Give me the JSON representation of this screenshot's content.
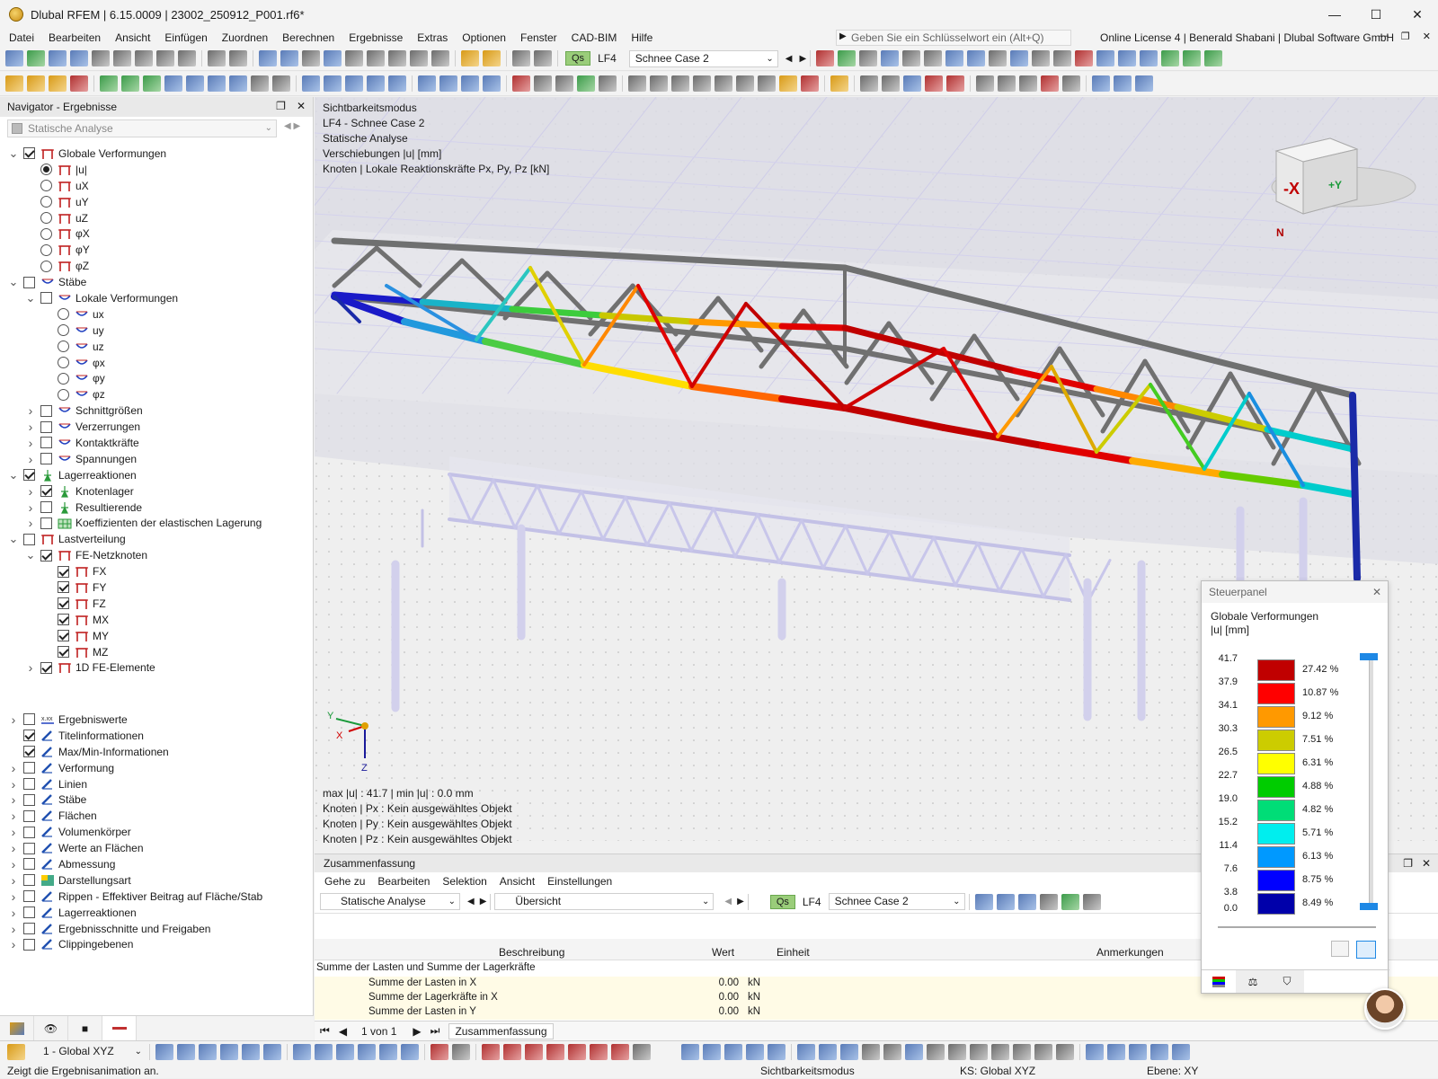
{
  "window": {
    "title": "Dlubal RFEM | 6.15.0009 | 23002_250912_P001.rf6*",
    "minimize": "—",
    "maximize": "☐",
    "close": "✕"
  },
  "menu": {
    "items": [
      "Datei",
      "Bearbeiten",
      "Ansicht",
      "Einfügen",
      "Zuordnen",
      "Berechnen",
      "Ergebnisse",
      "Extras",
      "Optionen",
      "Fenster",
      "CAD-BIM",
      "Hilfe"
    ],
    "search_placeholder": "Geben Sie ein Schlüsselwort ein (Alt+Q)",
    "license": "Online License 4 | Benerald Shabani | Dlubal Software GmbH"
  },
  "loadcase": {
    "badge": "Qs",
    "code": "LF4",
    "name": "Schnee Case 2"
  },
  "navigator": {
    "title": "Navigator - Ergebnisse",
    "combo": "Statische Analyse",
    "items": [
      {
        "label": "Globale Verformungen",
        "level": 0,
        "expand": "open",
        "ctl": "chk",
        "on": true,
        "icon": "red-frame"
      },
      {
        "label": "|u|",
        "level": 1,
        "expand": "",
        "ctl": "rad",
        "on": true,
        "icon": "red-frame"
      },
      {
        "label": "uX",
        "level": 1,
        "expand": "",
        "ctl": "rad",
        "on": false,
        "icon": "red-frame"
      },
      {
        "label": "uY",
        "level": 1,
        "expand": "",
        "ctl": "rad",
        "on": false,
        "icon": "red-frame"
      },
      {
        "label": "uZ",
        "level": 1,
        "expand": "",
        "ctl": "rad",
        "on": false,
        "icon": "red-frame"
      },
      {
        "label": "φX",
        "level": 1,
        "expand": "",
        "ctl": "rad",
        "on": false,
        "icon": "red-frame"
      },
      {
        "label": "φY",
        "level": 1,
        "expand": "",
        "ctl": "rad",
        "on": false,
        "icon": "red-frame"
      },
      {
        "label": "φZ",
        "level": 1,
        "expand": "",
        "ctl": "rad",
        "on": false,
        "icon": "red-frame"
      },
      {
        "label": "Stäbe",
        "level": 0,
        "expand": "open",
        "ctl": "chk",
        "on": false,
        "icon": "blue-beam"
      },
      {
        "label": "Lokale Verformungen",
        "level": 1,
        "expand": "open",
        "ctl": "chk",
        "on": false,
        "icon": "blue-beam"
      },
      {
        "label": "ux",
        "level": 2,
        "expand": "",
        "ctl": "rad",
        "on": false,
        "icon": "blue-beam"
      },
      {
        "label": "uy",
        "level": 2,
        "expand": "",
        "ctl": "rad",
        "on": false,
        "icon": "blue-beam"
      },
      {
        "label": "uz",
        "level": 2,
        "expand": "",
        "ctl": "rad",
        "on": false,
        "icon": "blue-beam"
      },
      {
        "label": "φx",
        "level": 2,
        "expand": "",
        "ctl": "rad",
        "on": false,
        "icon": "blue-beam"
      },
      {
        "label": "φy",
        "level": 2,
        "expand": "",
        "ctl": "rad",
        "on": false,
        "icon": "blue-beam"
      },
      {
        "label": "φz",
        "level": 2,
        "expand": "",
        "ctl": "rad",
        "on": false,
        "icon": "blue-beam"
      },
      {
        "label": "Schnittgrößen",
        "level": 1,
        "expand": "closed",
        "ctl": "chk",
        "on": false,
        "icon": "blue-beam"
      },
      {
        "label": "Verzerrungen",
        "level": 1,
        "expand": "closed",
        "ctl": "chk",
        "on": false,
        "icon": "blue-beam"
      },
      {
        "label": "Kontaktkräfte",
        "level": 1,
        "expand": "closed",
        "ctl": "chk",
        "on": false,
        "icon": "blue-beam"
      },
      {
        "label": "Spannungen",
        "level": 1,
        "expand": "closed",
        "ctl": "chk",
        "on": false,
        "icon": "blue-beam"
      },
      {
        "label": "Lagerreaktionen",
        "level": 0,
        "expand": "open",
        "ctl": "chk",
        "on": true,
        "icon": "green-support"
      },
      {
        "label": "Knotenlager",
        "level": 1,
        "expand": "closed",
        "ctl": "chk",
        "on": true,
        "icon": "green-support"
      },
      {
        "label": "Resultierende",
        "level": 1,
        "expand": "closed",
        "ctl": "chk",
        "on": false,
        "icon": "green-support"
      },
      {
        "label": "Koeffizienten der elastischen Lagerung",
        "level": 1,
        "expand": "closed",
        "ctl": "chk",
        "on": false,
        "icon": "green-grid"
      },
      {
        "label": "Lastverteilung",
        "level": 0,
        "expand": "open",
        "ctl": "chk",
        "on": false,
        "icon": "red-frame"
      },
      {
        "label": "FE-Netzknoten",
        "level": 1,
        "expand": "open",
        "ctl": "chk",
        "on": true,
        "icon": "red-frame"
      },
      {
        "label": "FX",
        "level": 2,
        "expand": "",
        "ctl": "chk",
        "on": true,
        "icon": "red-frame"
      },
      {
        "label": "FY",
        "level": 2,
        "expand": "",
        "ctl": "chk",
        "on": true,
        "icon": "red-frame"
      },
      {
        "label": "FZ",
        "level": 2,
        "expand": "",
        "ctl": "chk",
        "on": true,
        "icon": "red-frame"
      },
      {
        "label": "MX",
        "level": 2,
        "expand": "",
        "ctl": "chk",
        "on": true,
        "icon": "red-frame"
      },
      {
        "label": "MY",
        "level": 2,
        "expand": "",
        "ctl": "chk",
        "on": true,
        "icon": "red-frame"
      },
      {
        "label": "MZ",
        "level": 2,
        "expand": "",
        "ctl": "chk",
        "on": true,
        "icon": "red-frame"
      },
      {
        "label": "1D FE-Elemente",
        "level": 1,
        "expand": "closed",
        "ctl": "chk",
        "on": true,
        "icon": "red-frame"
      }
    ],
    "items2": [
      {
        "label": "Ergebniswerte",
        "level": 0,
        "expand": "closed",
        "ctl": "chk",
        "on": false,
        "icon": "xxx"
      },
      {
        "label": "Titelinformationen",
        "level": 0,
        "expand": "",
        "ctl": "chk",
        "on": true,
        "icon": "blue-pen"
      },
      {
        "label": "Max/Min-Informationen",
        "level": 0,
        "expand": "",
        "ctl": "chk",
        "on": true,
        "icon": "blue-pen"
      },
      {
        "label": "Verformung",
        "level": 0,
        "expand": "closed",
        "ctl": "chk",
        "on": false,
        "icon": "blue-pen"
      },
      {
        "label": "Linien",
        "level": 0,
        "expand": "closed",
        "ctl": "chk",
        "on": false,
        "icon": "blue-pen"
      },
      {
        "label": "Stäbe",
        "level": 0,
        "expand": "closed",
        "ctl": "chk",
        "on": false,
        "icon": "blue-pen"
      },
      {
        "label": "Flächen",
        "level": 0,
        "expand": "closed",
        "ctl": "chk",
        "on": false,
        "icon": "blue-pen"
      },
      {
        "label": "Volumenkörper",
        "level": 0,
        "expand": "closed",
        "ctl": "chk",
        "on": false,
        "icon": "blue-pen"
      },
      {
        "label": "Werte an Flächen",
        "level": 0,
        "expand": "closed",
        "ctl": "chk",
        "on": false,
        "icon": "blue-pen"
      },
      {
        "label": "Abmessung",
        "level": 0,
        "expand": "closed",
        "ctl": "chk",
        "on": false,
        "icon": "blue-pen"
      },
      {
        "label": "Darstellungsart",
        "level": 0,
        "expand": "closed",
        "ctl": "chk",
        "on": false,
        "icon": "rainbow"
      },
      {
        "label": "Rippen - Effektiver Beitrag auf Fläche/Stab",
        "level": 0,
        "expand": "closed",
        "ctl": "chk",
        "on": false,
        "icon": "blue-pen"
      },
      {
        "label": "Lagerreaktionen",
        "level": 0,
        "expand": "closed",
        "ctl": "chk",
        "on": false,
        "icon": "blue-pen"
      },
      {
        "label": "Ergebnisschnitte und Freigaben",
        "level": 0,
        "expand": "closed",
        "ctl": "chk",
        "on": false,
        "icon": "blue-pen"
      },
      {
        "label": "Clippingebenen",
        "level": 0,
        "expand": "closed",
        "ctl": "chk",
        "on": false,
        "icon": "blue-pen"
      }
    ]
  },
  "viewport": {
    "info_lines": [
      "Sichtbarkeitsmodus",
      "LF4 - Schnee Case 2",
      "Statische Analyse",
      "Verschiebungen |u| [mm]",
      "Knoten | Lokale Reaktionskräfte Px, Py, Pz [kN]"
    ],
    "footer_lines": [
      "max |u| : 41.7 | min |u| : 0.0 mm",
      "Knoten | Px : Kein ausgewähltes Objekt",
      "Knoten | Py : Kein ausgewähltes Objekt",
      "Knoten | Pz : Kein ausgewähltes Objekt"
    ],
    "axes": {
      "x": "X",
      "y": "Y",
      "z": "Z"
    },
    "cube": {
      "face": "-X",
      "side": "+Y",
      "north": "N"
    }
  },
  "summary": {
    "title": "Zusammenfassung",
    "menu": [
      "Gehe zu",
      "Bearbeiten",
      "Selektion",
      "Ansicht",
      "Einstellungen"
    ],
    "analysis": "Statische Analyse",
    "view": "Übersicht",
    "columns": {
      "desc": "Beschreibung",
      "value": "Wert",
      "unit": "Einheit",
      "notes": "Anmerkungen"
    },
    "group": "Summe der Lasten und Summe der Lagerkräfte",
    "rows": [
      {
        "desc": "Summe der Lasten in X",
        "value": "0.00",
        "unit": "kN"
      },
      {
        "desc": "Summe der Lagerkräfte in X",
        "value": "0.00",
        "unit": "kN"
      },
      {
        "desc": "Summe der Lasten in Y",
        "value": "0.00",
        "unit": "kN"
      }
    ],
    "pager": "1 von 1",
    "tab": "Zusammenfassung"
  },
  "control_panel": {
    "title": "Steuerpanel",
    "heading": "Globale Verformungen",
    "unit": "|u| [mm]",
    "legend": [
      {
        "value": "41.7",
        "color": "#c00000",
        "pct": "27.42 %"
      },
      {
        "value": "37.9",
        "color": "#ff0000",
        "pct": "10.87 %"
      },
      {
        "value": "34.1",
        "color": "#ff9900",
        "pct": "9.12 %"
      },
      {
        "value": "30.3",
        "color": "#cccc00",
        "pct": "7.51 %"
      },
      {
        "value": "26.5",
        "color": "#ffff00",
        "pct": "6.31 %"
      },
      {
        "value": "22.7",
        "color": "#00cc00",
        "pct": "4.88 %"
      },
      {
        "value": "19.0",
        "color": "#00dd77",
        "pct": "4.82 %"
      },
      {
        "value": "15.2",
        "color": "#00eeee",
        "pct": "5.71 %"
      },
      {
        "value": "11.4",
        "color": "#0099ff",
        "pct": "6.13 %"
      },
      {
        "value": "7.6",
        "color": "#0000ff",
        "pct": "8.75 %"
      },
      {
        "value": "3.8",
        "color": "#0000aa",
        "pct": "8.49 %"
      }
    ],
    "min_value": "0.0"
  },
  "status": {
    "coord_system": "1 - Global XYZ",
    "hint": "Zeigt die Ergebnisanimation an.",
    "mode": "Sichtbarkeitsmodus",
    "ks": "KS: Global XYZ",
    "plane": "Ebene: XY"
  }
}
